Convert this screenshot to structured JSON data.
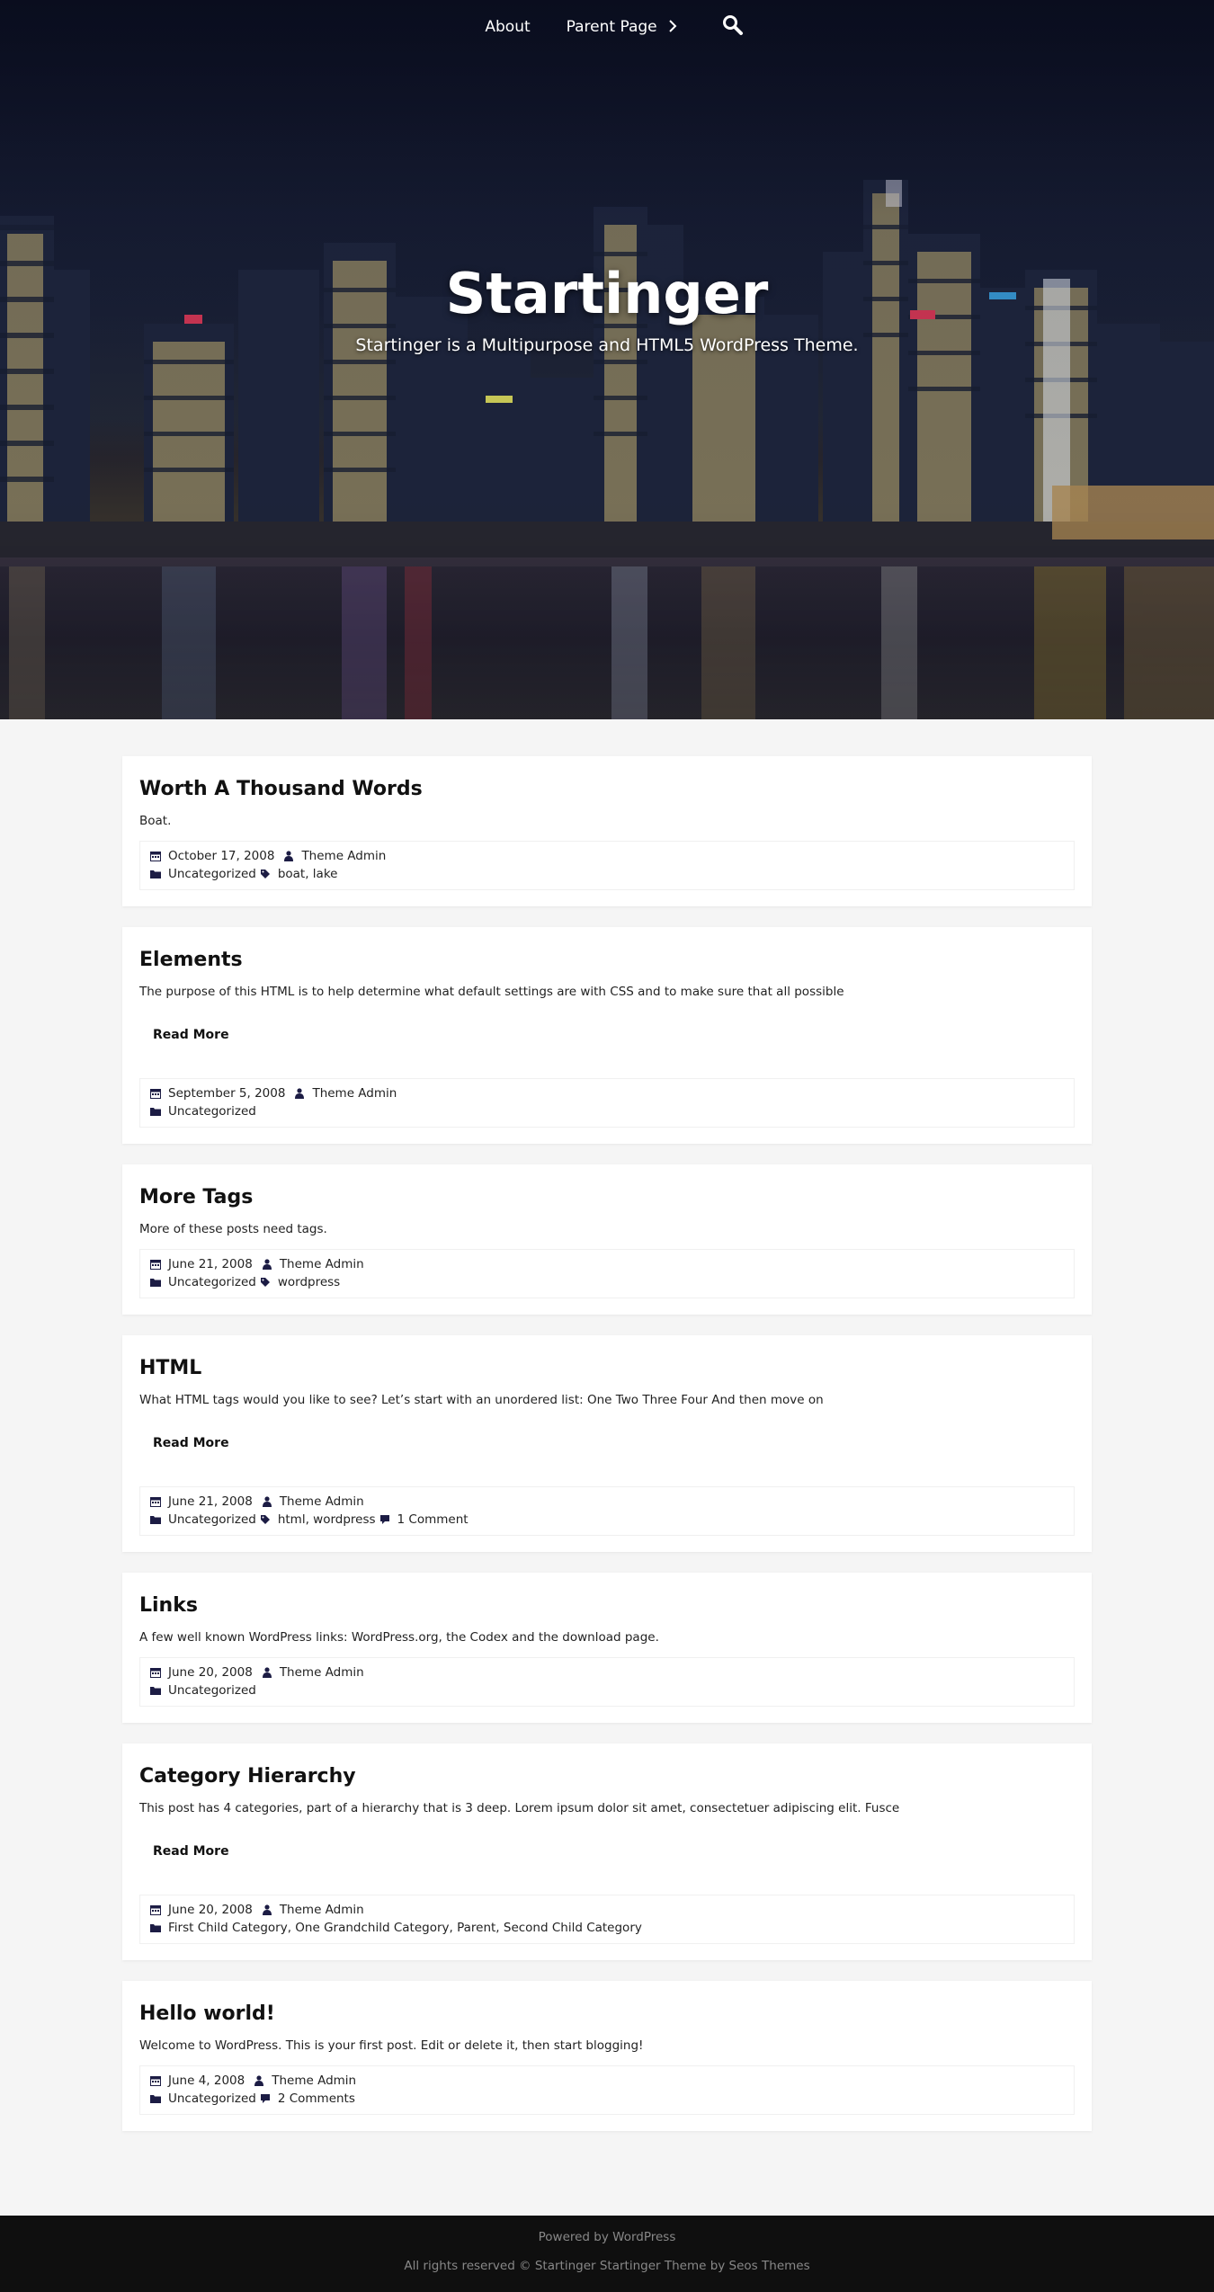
{
  "nav": {
    "items": [
      {
        "label": "About"
      },
      {
        "label": "Parent Page"
      }
    ],
    "search_icon": "search-icon"
  },
  "hero": {
    "title": "Startinger",
    "description": "Startinger is a Multipurpose and HTML5 WordPress Theme."
  },
  "posts": [
    {
      "title": "Worth A Thousand Words",
      "excerpt": "Boat.",
      "read_more": "",
      "date": "October 17, 2008",
      "author": "Theme Admin",
      "categories": "Uncategorized",
      "tags": "boat, lake",
      "comments": ""
    },
    {
      "title": "Elements",
      "excerpt": "The purpose of this HTML is to help determine what default settings are with CSS and to make sure that all possible",
      "read_more": "Read More",
      "date": "September 5, 2008",
      "author": "Theme Admin",
      "categories": "Uncategorized",
      "tags": "",
      "comments": ""
    },
    {
      "title": "More Tags",
      "excerpt": "More of these posts need tags.",
      "read_more": "",
      "date": "June 21, 2008",
      "author": "Theme Admin",
      "categories": "Uncategorized",
      "tags": "wordpress",
      "comments": ""
    },
    {
      "title": "HTML",
      "excerpt": "What HTML tags would you like to see? Let’s start with an unordered list: One Two Three Four And then move on",
      "read_more": "Read More",
      "date": "June 21, 2008",
      "author": "Theme Admin",
      "categories": "Uncategorized",
      "tags": "html, wordpress",
      "comments": "1 Comment"
    },
    {
      "title": "Links",
      "excerpt": "A few well known WordPress links: WordPress.org, the Codex and the download page.",
      "read_more": "",
      "date": "June 20, 2008",
      "author": "Theme Admin",
      "categories": "Uncategorized",
      "tags": "",
      "comments": ""
    },
    {
      "title": "Category Hierarchy",
      "excerpt": "This post has 4 categories, part of a hierarchy that is 3 deep. Lorem ipsum dolor sit amet, consectetuer adipiscing elit. Fusce",
      "read_more": "Read More",
      "date": "June 20, 2008",
      "author": "Theme Admin",
      "categories": "First Child Category, One Grandchild Category, Parent, Second Child Category",
      "tags": "",
      "comments": ""
    },
    {
      "title": "Hello world!",
      "excerpt": "Welcome to WordPress. This is your first post. Edit or delete it, then start blogging!",
      "read_more": "",
      "date": "June 4, 2008",
      "author": "Theme Admin",
      "categories": "Uncategorized",
      "tags": "",
      "comments": "2 Comments"
    }
  ],
  "footer": {
    "powered": "Powered by WordPress",
    "rights": "All rights reserved © Startinger Startinger Theme by Seos Themes"
  },
  "icons": {
    "date": "calendar-icon",
    "author": "user-icon",
    "categories": "folder-icon",
    "tags": "tag-icon",
    "comments": "comment-icon"
  },
  "colors": {
    "page_bg": "#f5f5f5",
    "card_bg": "#ffffff",
    "icon": "#1c1c44",
    "footer_bg": "#0f0f0f"
  }
}
